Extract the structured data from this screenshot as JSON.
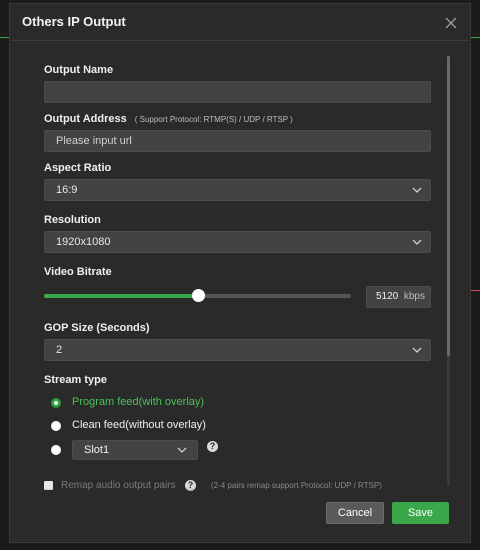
{
  "dialog": {
    "title": "Others IP Output",
    "close_icon": "close-icon"
  },
  "output_name": {
    "label": "Output Name",
    "value": ""
  },
  "output_address": {
    "label": "Output Address",
    "hint": "( Support Protocol: RTMP(S) / UDP / RTSP )",
    "placeholder": "Please input url"
  },
  "aspect_ratio": {
    "label": "Aspect Ratio",
    "value": "16:9"
  },
  "resolution": {
    "label": "Resolution",
    "value": "1920x1080"
  },
  "video_bitrate": {
    "label": "Video Bitrate",
    "value": "5120",
    "unit": "kbps",
    "slider_fraction": 0.5
  },
  "gop_size": {
    "label": "GOP Size (Seconds)",
    "value": "2"
  },
  "stream_type": {
    "label": "Stream type",
    "options": [
      {
        "label": "Program feed(with overlay)",
        "checked": true
      },
      {
        "label": "Clean feed(without overlay)",
        "checked": false
      },
      {
        "label": "",
        "checked": false
      }
    ],
    "slot_value": "Slot1"
  },
  "remap_audio": {
    "label": "Remap audio output pairs",
    "hint": "(2-4 pairs remap support Protocol: UDP / RTSP)"
  },
  "buttons": {
    "cancel": "Cancel",
    "save": "Save"
  },
  "colors": {
    "accent": "#3aa84a",
    "dialog_bg": "#2a2a2a",
    "field_bg": "#434343"
  }
}
